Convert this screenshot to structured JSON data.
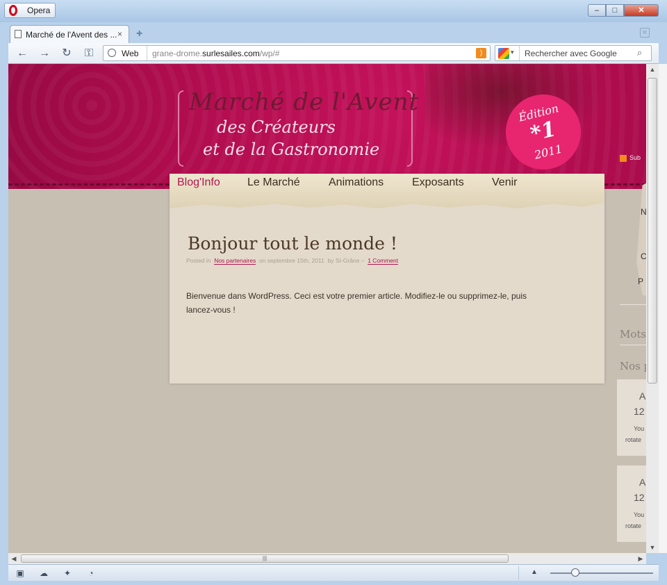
{
  "titlebar": {
    "app_label": "Opera",
    "min": "‒",
    "max": "□",
    "close": "✕"
  },
  "tabs": [
    {
      "title": "Marché de l'Avent des ...",
      "close": "×"
    }
  ],
  "newtab": "+",
  "trash": "✕",
  "navbar": {
    "back": "←",
    "forward": "→",
    "reload": "↻",
    "key": "⚿",
    "mode_label": "Web",
    "url_prefix": "grane-drome.",
    "url_domain": "surlesailes.com",
    "url_path": "/wp/#",
    "rss": ")"
  },
  "search": {
    "placeholder": "Rechercher avec Google",
    "dd": "▾",
    "mag": "⌕"
  },
  "site": {
    "logo_line1": "Marché de l'Avent",
    "logo_line2": "des Créateurs",
    "logo_line3": "et de la Gastronomie",
    "badge_line1": "Édition",
    "badge_line2": "*1",
    "badge_line3": "2011",
    "subscribe": "Sub",
    "menu": [
      "Blog'Info",
      "Le Marché",
      "Animations",
      "Exposants",
      "Venir"
    ],
    "post": {
      "title": "Bonjour tout le monde !",
      "meta_posted": "Posted in",
      "meta_category": "Nos partenaires",
      "meta_on": "on septembre 15th, 2011",
      "meta_by": "by SI-Grâne –",
      "meta_comments": "1 Comment",
      "body": "Bienvenue dans WordPress. Ceci est votre premier article. Modifiez-le ou supprimez-le, puis lancez-vous !"
    },
    "sidebar": {
      "card_letters": [
        "N",
        "C",
        "P"
      ],
      "title_mots": "Mots",
      "title_nos": "Nos p",
      "box1_a": "A",
      "box1_n": "12",
      "box1_you": "You",
      "box1_rot": "rotate",
      "box2_a": "A",
      "box2_n": "12",
      "box2_you": "You",
      "box2_rot": "rotate"
    }
  },
  "scroll": {
    "up": "▲",
    "down": "▼",
    "left": "◀",
    "right": "▶",
    "grip": "|||"
  },
  "statusbar": {
    "i1": "▣",
    "i2": "☁",
    "i3": "✦",
    "i4": "◔",
    "zoom_arrow": "▲",
    "zoom_level": 0.5
  }
}
